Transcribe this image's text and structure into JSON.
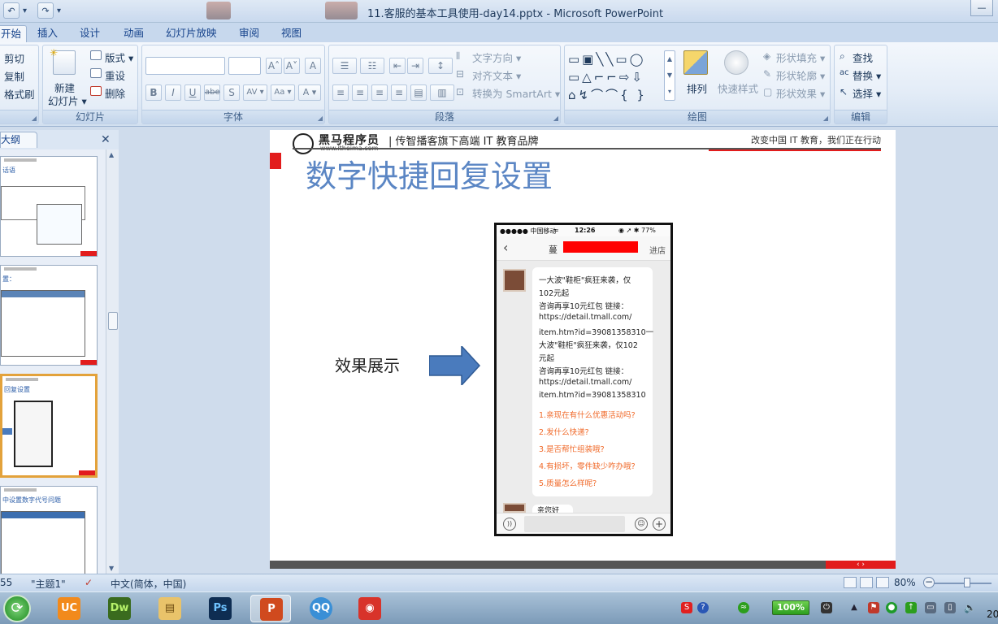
{
  "window": {
    "title": "11.客服的基本工具使用-day14.pptx - Microsoft PowerPoint",
    "controls": {
      "minimize": "—",
      "maximize": "□"
    }
  },
  "qat": {
    "undo": "↶",
    "undo_dropdown": "▾",
    "redo": "↷",
    "customize": "▾"
  },
  "ribbon_tabs": [
    "开始",
    "插入",
    "设计",
    "动画",
    "幻灯片放映",
    "审阅",
    "视图"
  ],
  "groups": {
    "clipboard": {
      "cut": "剪切",
      "copy": "复制",
      "format_painter": "格式刷"
    },
    "slides": {
      "label": "幻灯片",
      "new_slide_1": "新建",
      "new_slide_2": "幻灯片 ▾",
      "layout": "版式 ▾",
      "reset": "重设",
      "delete": "删除"
    },
    "font": {
      "label": "字体",
      "bold": "B",
      "italic": "I",
      "underline": "U",
      "strike": "abe",
      "shadow": "S",
      "spacing": "AV ▾",
      "case": "Aa ▾",
      "color": "A ▾",
      "grow": "A˄",
      "shrink": "A˅",
      "clear": "A"
    },
    "paragraph": {
      "label": "段落",
      "text_direction": "文字方向 ▾",
      "align_text": "对齐文本 ▾",
      "smartart": "转换为 SmartArt ▾"
    },
    "drawing": {
      "label": "绘图",
      "arrange": "排列",
      "quick_styles": "快速样式",
      "shape_fill": "形状填充 ▾",
      "shape_outline": "形状轮廓 ▾",
      "shape_effects": "形状效果 ▾"
    },
    "editing": {
      "label": "编辑",
      "find": "查找",
      "replace": "替换 ▾",
      "select": "选择 ▾"
    }
  },
  "left_pane": {
    "tab_label": "大纲",
    "close": "✕",
    "thumbnails": [
      {
        "title": "话语"
      },
      {
        "title": "置："
      },
      {
        "title": "回复设置"
      },
      {
        "title": "中设置数字代号问题"
      }
    ]
  },
  "slide": {
    "logo_name": "黑马程序员",
    "logo_url": "www.itheima.com",
    "slogan": "| 传智播客旗下高端 IT 教育品牌",
    "right_slogan": "改变中国 IT 教育，我们正在行动",
    "title": "数字快捷回复设置",
    "label": "效果展示",
    "bottom_arrows": "‹  ›"
  },
  "phone": {
    "carrier": "●●●●● 中国移动",
    "wifi": "≈",
    "time": "12:26",
    "battery": "◉ ➚ ✱ 77%",
    "shop_name": "蔓",
    "enter_shop": "进店",
    "message_lines": [
      "一大波\"鞋柜\"疯狂来袭，仅",
      "102元起",
      "咨询再享10元红包  链接：",
      "https://detail.tmall.com/",
      "item.htm?id=39081358310一",
      "大波\"鞋柜\"疯狂来袭，仅102",
      "元起",
      "咨询再享10元红包  链接：",
      "https://detail.tmall.com/",
      "item.htm?id=39081358310"
    ],
    "quick_replies": [
      "1.亲现在有什么优惠活动吗?",
      "2.发什么快递?",
      "3.是否帮忙组装哦?",
      "4.有损坏，零件缺少咋办哦?",
      "5.质量怎么样呢?"
    ],
    "second_message": "亲您好"
  },
  "statusbar": {
    "slide_no": "55",
    "theme": "\"主题1\"",
    "language": "中文(简体，中国)",
    "zoom": "80%",
    "zoom_out": "−",
    "zoom_in": "+"
  },
  "taskbar": {
    "start": "⟳",
    "apps": [
      "UC",
      "Dw",
      "▤",
      "Ps",
      "P",
      "QQ",
      "◉"
    ],
    "battery": "100%",
    "clock": "20",
    "tray_s": "S",
    "tray_help": "?"
  },
  "colors": {
    "accent_title": "#5b86c4",
    "brand_red": "#e21c1c",
    "reply_orange": "#f06a2a",
    "ribbon_text": "#15428b"
  }
}
